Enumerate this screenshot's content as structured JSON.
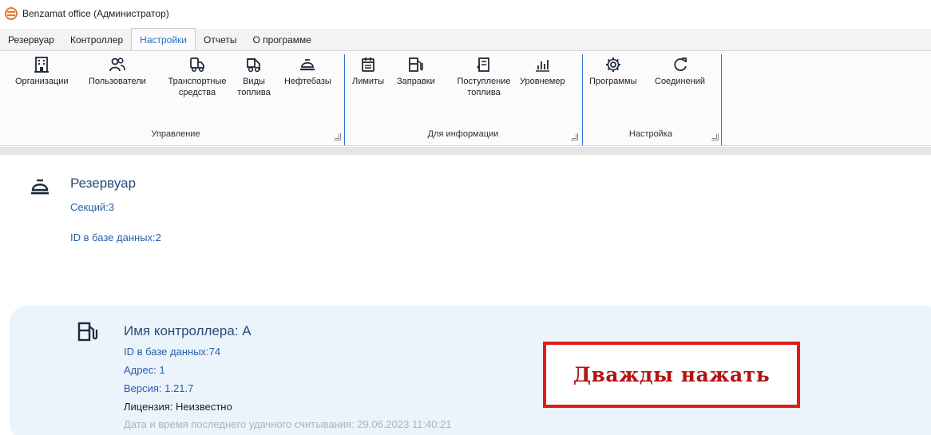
{
  "window": {
    "title": "Benzamat office (Администратор)",
    "logo_icon": "app-logo-icon"
  },
  "tabs": [
    {
      "label": "Резервуар",
      "active": false
    },
    {
      "label": "Контроллер",
      "active": false
    },
    {
      "label": "Настройки",
      "active": true
    },
    {
      "label": "Отчеты",
      "active": false
    },
    {
      "label": "О программе",
      "active": false
    }
  ],
  "ribbon": {
    "groups": [
      {
        "label": "Управление",
        "buttons": [
          {
            "label": "Организации",
            "icon": "building-icon"
          },
          {
            "label": "Пользователи",
            "icon": "users-icon"
          },
          {
            "label": "Транспортные средства",
            "icon": "truck-icon"
          },
          {
            "label": "Виды топлива",
            "icon": "fuel-types-icon"
          },
          {
            "label": "Нефтебазы",
            "icon": "oil-depot-icon"
          }
        ]
      },
      {
        "label": "Для информации",
        "buttons": [
          {
            "label": "Лимиты",
            "icon": "calendar-icon"
          },
          {
            "label": "Заправки",
            "icon": "fuel-pump-icon"
          },
          {
            "label": "Поступление топлива",
            "icon": "fuel-intake-icon"
          },
          {
            "label": "Уровнемер",
            "icon": "bar-chart-icon"
          }
        ]
      },
      {
        "label": "Настройка",
        "buttons": [
          {
            "label": "Программы",
            "icon": "gear-icon"
          },
          {
            "label": "Соединений",
            "icon": "refresh-icon"
          }
        ]
      }
    ]
  },
  "tank": {
    "title": "Резервуар",
    "sections": "Секций:3",
    "db_id": "ID в базе данных:2"
  },
  "controller": {
    "title": "Имя контроллера: A",
    "db_id": "ID в базе данных:74",
    "address": "Адрес: 1",
    "version": "Версия: 1.21.7",
    "license": "Лицензия: Неизвестно",
    "last_read": "Дата и время последнего удачного считывания: 29.06.2023 11:40:21"
  },
  "callout": {
    "text": "Дважды нажать"
  },
  "colors": {
    "accent": "#2b6fc6",
    "separator": "#2f6fcc",
    "card_bg": "#ebf3fb",
    "callout_border": "#e11b1b",
    "callout_text": "#b31313"
  }
}
